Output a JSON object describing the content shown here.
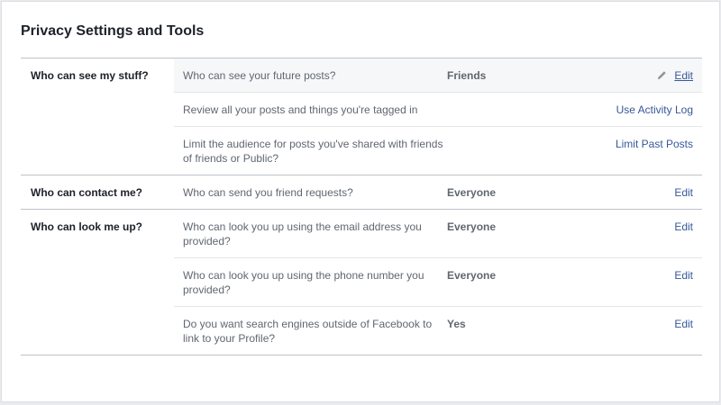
{
  "page": {
    "title": "Privacy Settings and Tools"
  },
  "sections": [
    {
      "label": "Who can see my stuff?",
      "rows": [
        {
          "question": "Who can see your future posts?",
          "value": "Friends",
          "action": "Edit",
          "icon": "pencil-icon"
        },
        {
          "question": "Review all your posts and things you're tagged in",
          "value": "",
          "action": "Use Activity Log"
        },
        {
          "question": "Limit the audience for posts you've shared with friends of friends or Public?",
          "value": "",
          "action": "Limit Past Posts"
        }
      ]
    },
    {
      "label": "Who can contact me?",
      "rows": [
        {
          "question": "Who can send you friend requests?",
          "value": "Everyone",
          "action": "Edit"
        }
      ]
    },
    {
      "label": "Who can look me up?",
      "rows": [
        {
          "question": "Who can look you up using the email address you provided?",
          "value": "Everyone",
          "action": "Edit"
        },
        {
          "question": "Who can look you up using the phone number you provided?",
          "value": "Everyone",
          "action": "Edit"
        },
        {
          "question": "Do you want search engines outside of Facebook to link to your Profile?",
          "value": "Yes",
          "action": "Edit"
        }
      ]
    }
  ],
  "colors": {
    "link": "#365899",
    "muted_text": "#606770",
    "heading_text": "#1d2129",
    "row_highlight": "#f6f7f9"
  }
}
